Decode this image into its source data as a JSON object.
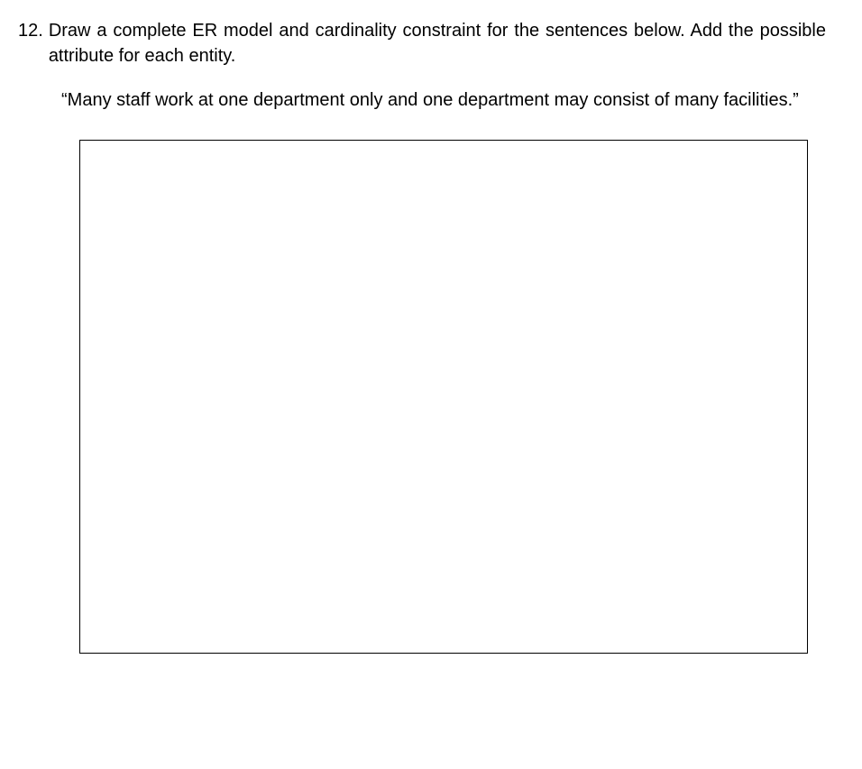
{
  "question": {
    "number": "12.",
    "text": "Draw a complete ER model and cardinality constraint for the sentences below. Add the possible attribute for each entity."
  },
  "quote": {
    "text": "“Many staff work at one department only and one department may consist of many facilities.”"
  }
}
